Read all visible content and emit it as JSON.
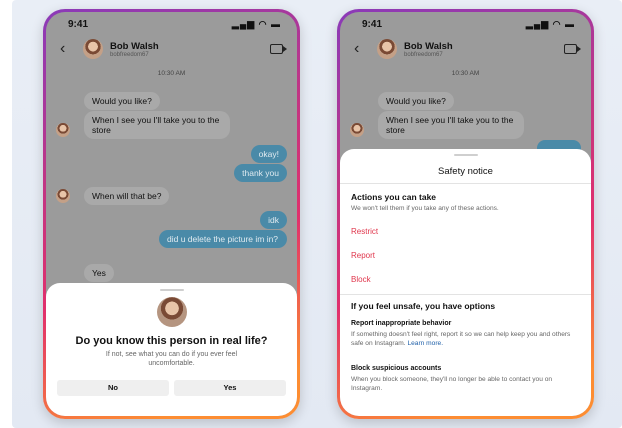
{
  "status": {
    "time": "9:41",
    "icons": "▂▄▆ ◠ ▬"
  },
  "conversation": {
    "name": "Bob Walsh",
    "handle": "bobfreedom67",
    "timestamp": "10:30 AM",
    "messages": {
      "m1": "Would you like?",
      "m2": "When I see you I'll take you to the store",
      "m3": "okay!",
      "m4": "thank you",
      "m5": "When will that be?",
      "m6": "idk",
      "m7": "did u delete the picture im in?",
      "m8": "Yes"
    }
  },
  "prompt": {
    "title": "Do you know this person in real life?",
    "subtitle": "If not, see what you can do if you ever feel uncomfortable.",
    "no_label": "No",
    "yes_label": "Yes"
  },
  "safety": {
    "title": "Safety notice",
    "actions_heading": "Actions you can take",
    "actions_text": "We won't tell them if you take any of these actions.",
    "restrict": "Restrict",
    "report": "Report",
    "block": "Block",
    "unsafe_heading": "If you feel unsafe, you have options",
    "report_behavior_title": "Report inappropriate behavior",
    "report_behavior_text": "If something doesn't feel right, report it so we can help keep you and others safe on Instagram.",
    "learn_more": "Learn more.",
    "block_title": "Block suspicious accounts",
    "block_text": "When you block someone, they'll no longer be able to contact you on Instagram."
  },
  "colors": {
    "accent": "#e0364c",
    "link": "#1e5fa8",
    "outgoing": "#4a8aa8"
  }
}
